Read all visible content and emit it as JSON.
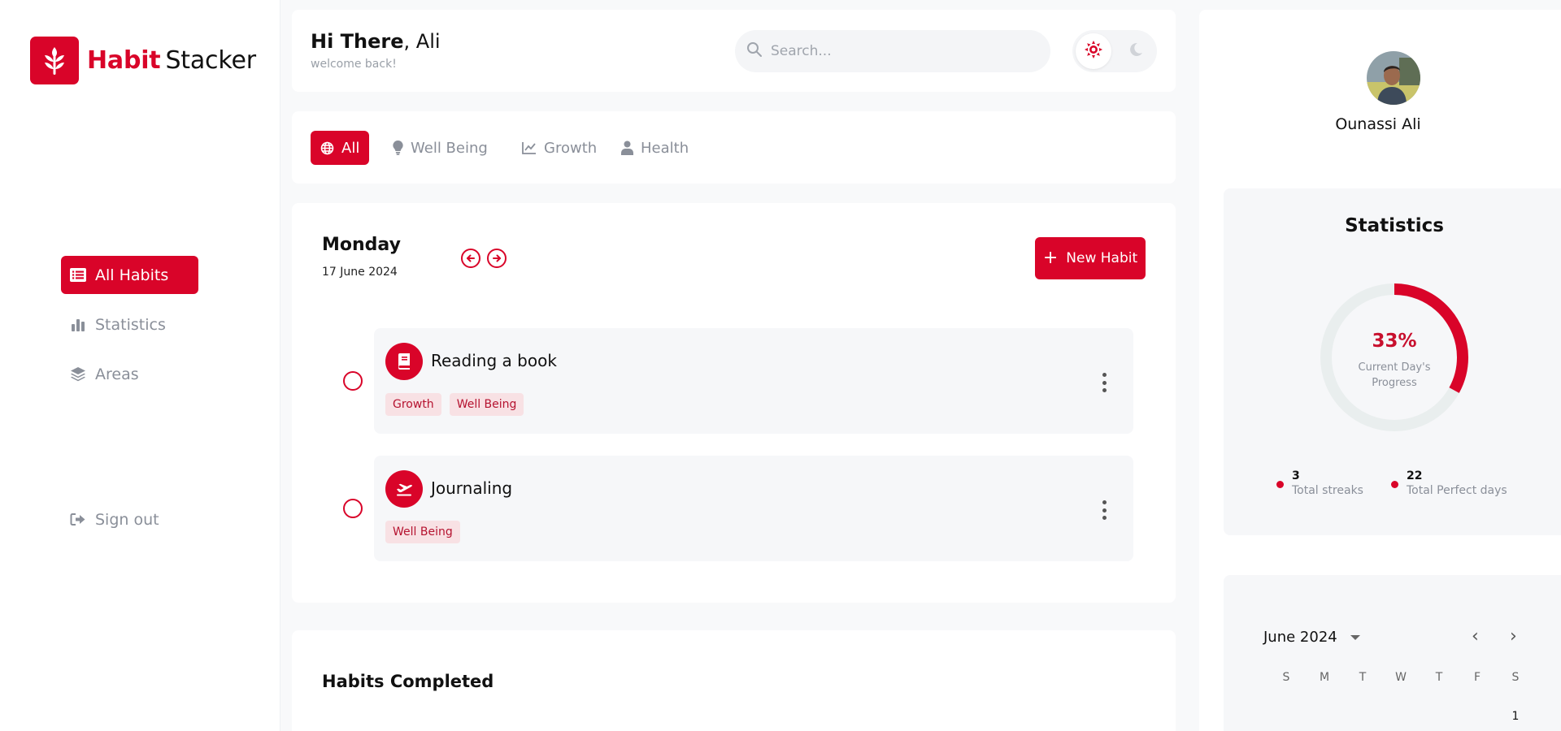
{
  "app": {
    "brand_primary": "Habit",
    "brand_secondary": "Stacker",
    "accent_color": "#d90429"
  },
  "sidebar": {
    "items": [
      {
        "label": "All Habits",
        "icon": "list-icon",
        "active": true
      },
      {
        "label": "Statistics",
        "icon": "bar-chart-icon",
        "active": false
      },
      {
        "label": "Areas",
        "icon": "layers-icon",
        "active": false
      }
    ],
    "sign_out": {
      "label": "Sign out",
      "icon": "sign-out-icon"
    }
  },
  "header": {
    "greeting_bold": "Hi There",
    "greeting_name": ", Ali",
    "subtitle": "welcome back!",
    "search_placeholder": "Search...",
    "theme_active": "light"
  },
  "filters": [
    {
      "label": "All",
      "icon": "globe-icon",
      "active": true
    },
    {
      "label": "Well Being",
      "icon": "lightbulb-icon",
      "active": false
    },
    {
      "label": "Growth",
      "icon": "line-chart-icon",
      "active": false
    },
    {
      "label": "Health",
      "icon": "user-icon",
      "active": false
    }
  ],
  "day": {
    "name": "Monday",
    "date": "17 June 2024",
    "new_habit_label": "New Habit"
  },
  "habits": [
    {
      "name": "Reading a book",
      "icon": "book-icon",
      "tags": [
        "Growth",
        "Well Being"
      ],
      "completed": false
    },
    {
      "name": "Journaling",
      "icon": "plane-icon",
      "tags": [
        "Well Being"
      ],
      "completed": false
    }
  ],
  "completed": {
    "title": "Habits Completed"
  },
  "profile": {
    "name": "Ounassi Ali"
  },
  "statistics": {
    "title": "Statistics",
    "progress_percent": 33,
    "progress_text": "33%",
    "progress_label": "Current Day's Progress",
    "total_streaks_value": "3",
    "total_streaks_label": "Total streaks",
    "perfect_days_value": "22",
    "perfect_days_label": "Total Perfect days"
  },
  "calendar": {
    "month_label": "June 2024",
    "weekdays": [
      "S",
      "M",
      "T",
      "W",
      "T",
      "F",
      "S"
    ],
    "first_day": "1"
  }
}
